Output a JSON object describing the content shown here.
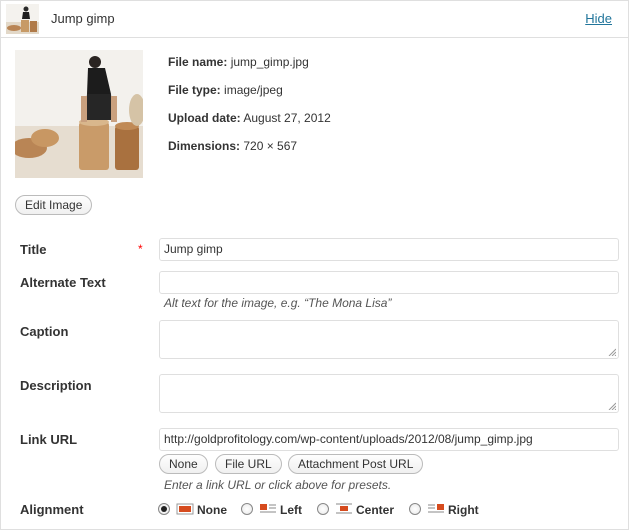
{
  "header": {
    "title": "Jump gimp",
    "hide_label": "Hide"
  },
  "file_info": {
    "file_name_label": "File name:",
    "file_name": "jump_gimp.jpg",
    "file_type_label": "File type:",
    "file_type": "image/jpeg",
    "upload_date_label": "Upload date:",
    "upload_date": "August 27, 2012",
    "dimensions_label": "Dimensions:",
    "dimensions": "720 × 567"
  },
  "edit_image_label": "Edit Image",
  "fields": {
    "title_label": "Title",
    "title_required_mark": "*",
    "title_value": "Jump gimp",
    "alt_label": "Alternate Text",
    "alt_value": "",
    "alt_help": "Alt text for the image, e.g. “The Mona Lisa”",
    "caption_label": "Caption",
    "description_label": "Description",
    "link_url_label": "Link URL",
    "link_url_value": "http://goldprofitology.com/wp-content/uploads/2012/08/jump_gimp.jpg",
    "link_buttons": {
      "none": "None",
      "file_url": "File URL",
      "attachment_post_url": "Attachment Post URL"
    },
    "link_help": "Enter a link URL or click above for presets.",
    "alignment_label": "Alignment",
    "alignment_options": {
      "none": "None",
      "left": "Left",
      "center": "Center",
      "right": "Right"
    },
    "alignment_selected": "None"
  },
  "colors": {
    "link": "#21759b",
    "required": "#ff0000",
    "border": "#dfdfdf"
  }
}
